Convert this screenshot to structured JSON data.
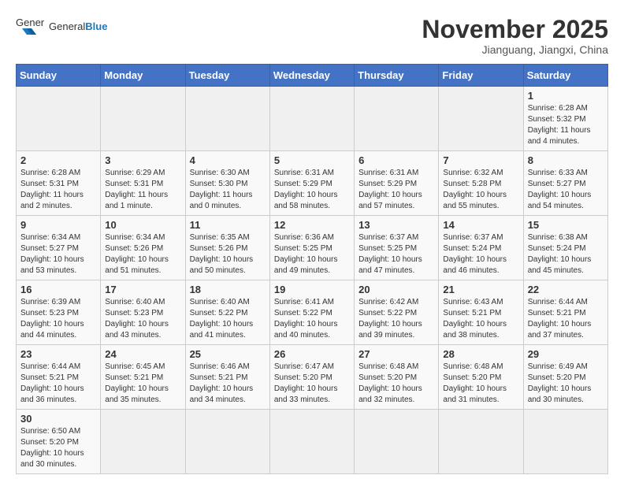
{
  "header": {
    "logo_general": "General",
    "logo_blue": "Blue",
    "title": "November 2025",
    "location": "Jianguang, Jiangxi, China"
  },
  "weekdays": [
    "Sunday",
    "Monday",
    "Tuesday",
    "Wednesday",
    "Thursday",
    "Friday",
    "Saturday"
  ],
  "weeks": [
    [
      {
        "day": "",
        "info": ""
      },
      {
        "day": "",
        "info": ""
      },
      {
        "day": "",
        "info": ""
      },
      {
        "day": "",
        "info": ""
      },
      {
        "day": "",
        "info": ""
      },
      {
        "day": "",
        "info": ""
      },
      {
        "day": "1",
        "info": "Sunrise: 6:28 AM\nSunset: 5:32 PM\nDaylight: 11 hours and 4 minutes."
      }
    ],
    [
      {
        "day": "2",
        "info": "Sunrise: 6:28 AM\nSunset: 5:31 PM\nDaylight: 11 hours and 2 minutes."
      },
      {
        "day": "3",
        "info": "Sunrise: 6:29 AM\nSunset: 5:31 PM\nDaylight: 11 hours and 1 minute."
      },
      {
        "day": "4",
        "info": "Sunrise: 6:30 AM\nSunset: 5:30 PM\nDaylight: 11 hours and 0 minutes."
      },
      {
        "day": "5",
        "info": "Sunrise: 6:31 AM\nSunset: 5:29 PM\nDaylight: 10 hours and 58 minutes."
      },
      {
        "day": "6",
        "info": "Sunrise: 6:31 AM\nSunset: 5:29 PM\nDaylight: 10 hours and 57 minutes."
      },
      {
        "day": "7",
        "info": "Sunrise: 6:32 AM\nSunset: 5:28 PM\nDaylight: 10 hours and 55 minutes."
      },
      {
        "day": "8",
        "info": "Sunrise: 6:33 AM\nSunset: 5:27 PM\nDaylight: 10 hours and 54 minutes."
      }
    ],
    [
      {
        "day": "9",
        "info": "Sunrise: 6:34 AM\nSunset: 5:27 PM\nDaylight: 10 hours and 53 minutes."
      },
      {
        "day": "10",
        "info": "Sunrise: 6:34 AM\nSunset: 5:26 PM\nDaylight: 10 hours and 51 minutes."
      },
      {
        "day": "11",
        "info": "Sunrise: 6:35 AM\nSunset: 5:26 PM\nDaylight: 10 hours and 50 minutes."
      },
      {
        "day": "12",
        "info": "Sunrise: 6:36 AM\nSunset: 5:25 PM\nDaylight: 10 hours and 49 minutes."
      },
      {
        "day": "13",
        "info": "Sunrise: 6:37 AM\nSunset: 5:25 PM\nDaylight: 10 hours and 47 minutes."
      },
      {
        "day": "14",
        "info": "Sunrise: 6:37 AM\nSunset: 5:24 PM\nDaylight: 10 hours and 46 minutes."
      },
      {
        "day": "15",
        "info": "Sunrise: 6:38 AM\nSunset: 5:24 PM\nDaylight: 10 hours and 45 minutes."
      }
    ],
    [
      {
        "day": "16",
        "info": "Sunrise: 6:39 AM\nSunset: 5:23 PM\nDaylight: 10 hours and 44 minutes."
      },
      {
        "day": "17",
        "info": "Sunrise: 6:40 AM\nSunset: 5:23 PM\nDaylight: 10 hours and 43 minutes."
      },
      {
        "day": "18",
        "info": "Sunrise: 6:40 AM\nSunset: 5:22 PM\nDaylight: 10 hours and 41 minutes."
      },
      {
        "day": "19",
        "info": "Sunrise: 6:41 AM\nSunset: 5:22 PM\nDaylight: 10 hours and 40 minutes."
      },
      {
        "day": "20",
        "info": "Sunrise: 6:42 AM\nSunset: 5:22 PM\nDaylight: 10 hours and 39 minutes."
      },
      {
        "day": "21",
        "info": "Sunrise: 6:43 AM\nSunset: 5:21 PM\nDaylight: 10 hours and 38 minutes."
      },
      {
        "day": "22",
        "info": "Sunrise: 6:44 AM\nSunset: 5:21 PM\nDaylight: 10 hours and 37 minutes."
      }
    ],
    [
      {
        "day": "23",
        "info": "Sunrise: 6:44 AM\nSunset: 5:21 PM\nDaylight: 10 hours and 36 minutes."
      },
      {
        "day": "24",
        "info": "Sunrise: 6:45 AM\nSunset: 5:21 PM\nDaylight: 10 hours and 35 minutes."
      },
      {
        "day": "25",
        "info": "Sunrise: 6:46 AM\nSunset: 5:21 PM\nDaylight: 10 hours and 34 minutes."
      },
      {
        "day": "26",
        "info": "Sunrise: 6:47 AM\nSunset: 5:20 PM\nDaylight: 10 hours and 33 minutes."
      },
      {
        "day": "27",
        "info": "Sunrise: 6:48 AM\nSunset: 5:20 PM\nDaylight: 10 hours and 32 minutes."
      },
      {
        "day": "28",
        "info": "Sunrise: 6:48 AM\nSunset: 5:20 PM\nDaylight: 10 hours and 31 minutes."
      },
      {
        "day": "29",
        "info": "Sunrise: 6:49 AM\nSunset: 5:20 PM\nDaylight: 10 hours and 30 minutes."
      }
    ],
    [
      {
        "day": "30",
        "info": "Sunrise: 6:50 AM\nSunset: 5:20 PM\nDaylight: 10 hours and 30 minutes."
      },
      {
        "day": "",
        "info": ""
      },
      {
        "day": "",
        "info": ""
      },
      {
        "day": "",
        "info": ""
      },
      {
        "day": "",
        "info": ""
      },
      {
        "day": "",
        "info": ""
      },
      {
        "day": "",
        "info": ""
      }
    ]
  ]
}
